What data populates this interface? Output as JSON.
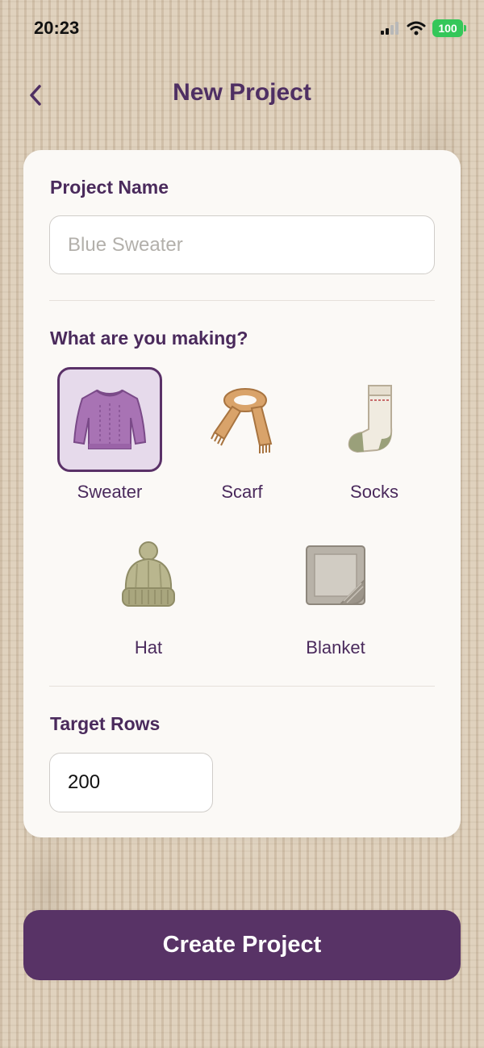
{
  "status_bar": {
    "time": "20:23",
    "battery": "100"
  },
  "nav": {
    "title": "New Project",
    "back_icon": "chevron-left-icon"
  },
  "form": {
    "name_label": "Project Name",
    "name_placeholder": "Blue Sweater",
    "name_value": "",
    "type_label": "What are you making?",
    "types": [
      {
        "label": "Sweater",
        "icon": "sweater-icon",
        "selected": true
      },
      {
        "label": "Scarf",
        "icon": "scarf-icon",
        "selected": false
      },
      {
        "label": "Socks",
        "icon": "socks-icon",
        "selected": false
      },
      {
        "label": "Hat",
        "icon": "hat-icon",
        "selected": false
      },
      {
        "label": "Blanket",
        "icon": "blanket-icon",
        "selected": false
      }
    ],
    "rows_label": "Target Rows",
    "rows_value": "200"
  },
  "create_button": {
    "label": "Create Project"
  },
  "colors": {
    "accent": "#583366",
    "selected_bg": "#e6daeb",
    "card": "#fbf9f6"
  }
}
